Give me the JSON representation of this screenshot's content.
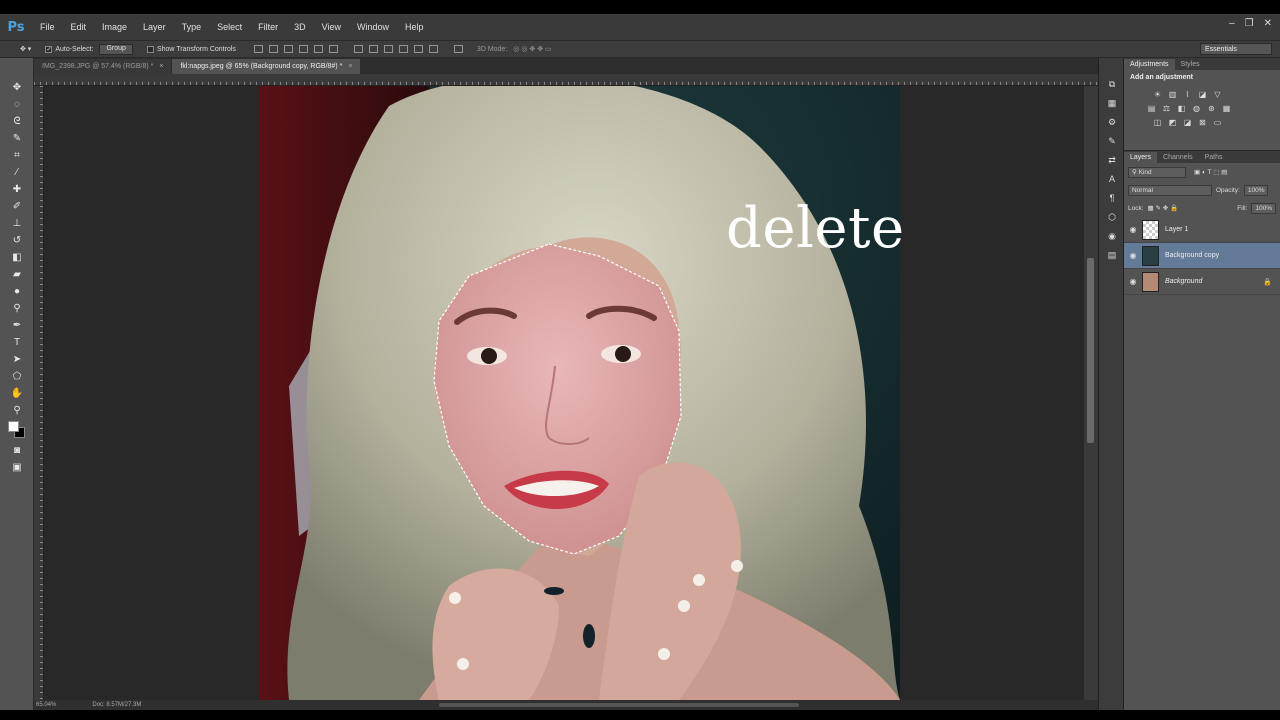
{
  "app": {
    "logo": "Ps"
  },
  "menu": [
    "File",
    "Edit",
    "Image",
    "Layer",
    "Type",
    "Select",
    "Filter",
    "3D",
    "View",
    "Window",
    "Help"
  ],
  "window_controls": [
    "–",
    "❐",
    "✕"
  ],
  "options": {
    "auto_select_label": "Auto-Select:",
    "auto_select_value": "Group",
    "show_transform_label": "Show Transform Controls",
    "mode_3d_label": "3D Mode:",
    "workspace": "Essentials"
  },
  "tabs": [
    {
      "label": "IMG_2398.JPG @ 57.4% (RGB/8) *",
      "active": false
    },
    {
      "label": "fkl:napgs.jpeg @ 65% (Background copy, RGB/8#) *",
      "active": true
    }
  ],
  "canvas": {
    "caption": "delete"
  },
  "status": {
    "zoom": "65.04%",
    "doc": "Doc: 8.57M/27.3M"
  },
  "panels": {
    "adjustments_tab": "Adjustments",
    "styles_tab": "Styles",
    "adjustments_title": "Add an adjustment",
    "layers_tab": "Layers",
    "channels_tab": "Channels",
    "paths_tab": "Paths",
    "kind_label": "Kind",
    "blend_mode": "Normal",
    "opacity_label": "Opacity:",
    "opacity_value": "100%",
    "lock_label": "Lock:",
    "fill_label": "Fill:",
    "fill_value": "100%"
  },
  "layers": [
    {
      "name": "Layer 1",
      "selected": false,
      "italic": false,
      "locked": false
    },
    {
      "name": "Background copy",
      "selected": true,
      "italic": false,
      "locked": false
    },
    {
      "name": "Background",
      "selected": false,
      "italic": true,
      "locked": true
    }
  ],
  "colors": {
    "accent": "#637a99",
    "ps_blue": "#4aa3e0"
  }
}
